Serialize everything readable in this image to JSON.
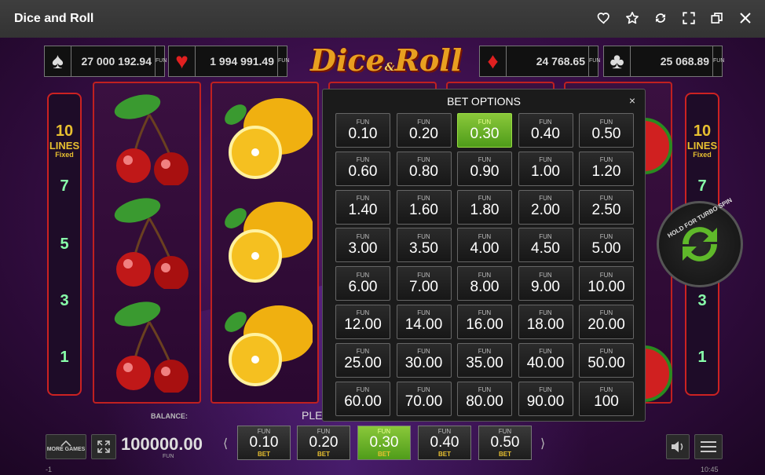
{
  "window": {
    "title": "Dice and Roll"
  },
  "jackpots": [
    {
      "suit": "♠",
      "amount": "27 000 192.94",
      "fun": "FUN",
      "color": "#dddddd"
    },
    {
      "suit": "♥",
      "amount": "1 994 991.49",
      "fun": "FUN",
      "color": "#e02020"
    },
    {
      "suit": "♦",
      "amount": "24 768.65",
      "fun": "FUN",
      "color": "#e02020"
    },
    {
      "suit": "♣",
      "amount": "25 068.89",
      "fun": "FUN",
      "color": "#dddddd"
    }
  ],
  "logo": {
    "top": "Dice",
    "amp": "&",
    "bottom": "Roll"
  },
  "lines_panel": {
    "count": "10",
    "label": "LINES",
    "sub": "Fixed",
    "numbers": [
      "7",
      "5",
      "3",
      "1"
    ]
  },
  "turbo": {
    "label": "HOLD FOR TURBO SPIN"
  },
  "bet_dialog": {
    "title": "BET OPTIONS",
    "close": "×",
    "fun_label": "FUN",
    "selected": "0.30",
    "options": [
      "0.10",
      "0.20",
      "0.30",
      "0.40",
      "0.50",
      "0.60",
      "0.80",
      "0.90",
      "1.00",
      "1.20",
      "1.40",
      "1.60",
      "1.80",
      "2.00",
      "2.50",
      "3.00",
      "3.50",
      "4.00",
      "4.50",
      "5.00",
      "6.00",
      "7.00",
      "8.00",
      "9.00",
      "10.00",
      "12.00",
      "14.00",
      "16.00",
      "18.00",
      "20.00",
      "25.00",
      "30.00",
      "35.00",
      "40.00",
      "50.00",
      "60.00",
      "70.00",
      "80.00",
      "90.00",
      "100"
    ]
  },
  "bottom": {
    "more_games": "MORE GAMES",
    "balance_label": "BALANCE:",
    "balance_value": "100000.00",
    "balance_fun": "FUN",
    "please_text": "PLE",
    "bets": [
      {
        "fun": "FUN",
        "value": "0.10",
        "bet": "BET"
      },
      {
        "fun": "FUN",
        "value": "0.20",
        "bet": "BET"
      },
      {
        "fun": "FUN",
        "value": "0.30",
        "bet": "BET",
        "selected": true
      },
      {
        "fun": "FUN",
        "value": "0.40",
        "bet": "BET"
      },
      {
        "fun": "FUN",
        "value": "0.50",
        "bet": "BET"
      }
    ],
    "arrow_left": "⟨",
    "arrow_right": "⟩",
    "footer_left": "-1",
    "footer_right": "10:45"
  },
  "colors": {
    "accent_green": "#6bb22a",
    "reel_border": "#c02020",
    "gold": "#e8c030"
  }
}
